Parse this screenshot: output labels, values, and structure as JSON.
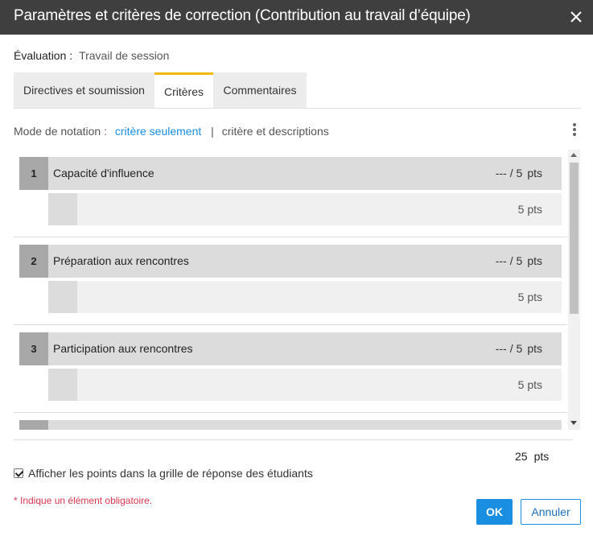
{
  "dialog": {
    "title": "Paramètres et critères de correction (Contribution au travail d’équipe)",
    "close_icon": "close-icon"
  },
  "evaluation": {
    "label": "Évaluation :",
    "value": "Travail de session"
  },
  "tabs": [
    {
      "label": "Directives et soumission",
      "active": false
    },
    {
      "label": "Critères",
      "active": true
    },
    {
      "label": "Commentaires",
      "active": false
    }
  ],
  "grading_mode": {
    "label": "Mode de notation :",
    "selected": "critère seulement",
    "separator": "|",
    "other": "critère et descriptions",
    "menu_icon": "more-vertical-icon"
  },
  "criteria": [
    {
      "number": "1",
      "title": "Capacité d'influence",
      "score": "---",
      "slash": "/",
      "max": "5",
      "unit": "pts",
      "row_points": "5 pts"
    },
    {
      "number": "2",
      "title": "Préparation aux rencontres",
      "score": "---",
      "slash": "/",
      "max": "5",
      "unit": "pts",
      "row_points": "5 pts"
    },
    {
      "number": "3",
      "title": "Participation aux rencontres",
      "score": "---",
      "slash": "/",
      "max": "5",
      "unit": "pts",
      "row_points": "5 pts"
    }
  ],
  "total": {
    "value": "25",
    "unit": "pts"
  },
  "show_points": {
    "checked": true,
    "label": "Afficher les points dans la grille de réponse des étudiants"
  },
  "required_note": "* Indique un élément obligatoire.",
  "buttons": {
    "ok": "OK",
    "cancel": "Annuler"
  },
  "colors": {
    "titlebar": "#3f3f3f",
    "accent": "#1a8ee0",
    "active_tab": "#f5b800",
    "required": "#d9364f"
  }
}
